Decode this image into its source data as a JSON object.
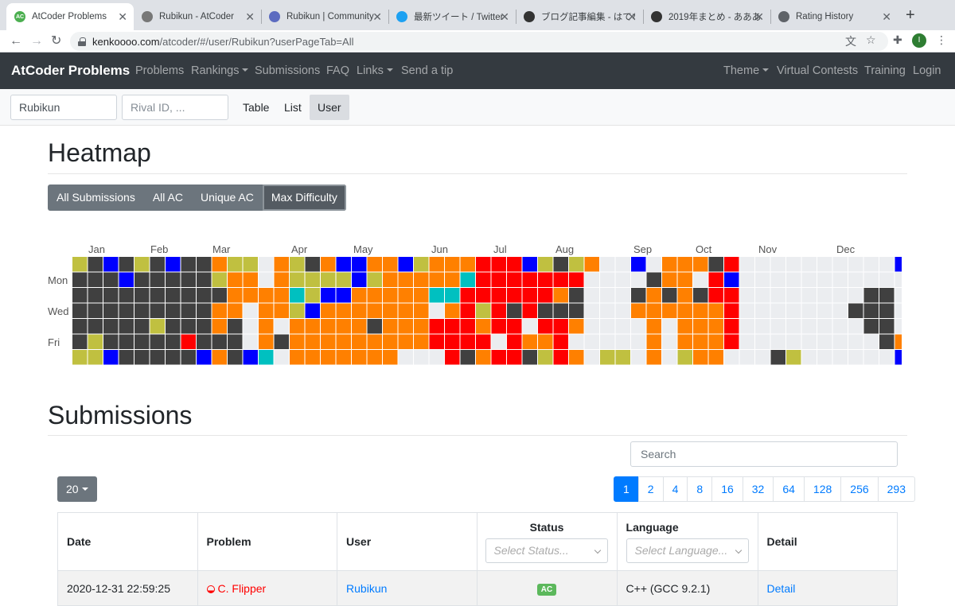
{
  "browser": {
    "tabs": [
      {
        "title": "AtCoder Problems",
        "icon": "atcoder-icon",
        "color": "#4caf50"
      },
      {
        "title": "Rubikun - AtCoder",
        "icon": "atcoder-logo-icon",
        "color": "#777777"
      },
      {
        "title": "Rubikun | Community",
        "icon": "community-icon",
        "color": "#5c6bc0"
      },
      {
        "title": "最新ツイート / Twitter",
        "icon": "twitter-icon",
        "color": "#1da1f2"
      },
      {
        "title": "ブログ記事編集 - はてな",
        "icon": "hatena-icon",
        "color": "#333333"
      },
      {
        "title": "2019年まとめ - あああ",
        "icon": "hatena-icon",
        "color": "#333333"
      },
      {
        "title": "Rating History",
        "icon": "globe-icon",
        "color": "#5f6368"
      }
    ],
    "url_host": "kenkoooo.com",
    "url_path": "/atcoder/#/user/Rubikun?userPageTab=All",
    "profile_initial": "I"
  },
  "navbar": {
    "brand": "AtCoder Problems",
    "links": [
      "Problems",
      "Rankings",
      "Submissions",
      "FAQ",
      "Links",
      "Send a tip"
    ],
    "right_links": [
      "Theme",
      "Virtual Contests",
      "Training",
      "Login"
    ]
  },
  "userbar": {
    "user_value": "Rubikun",
    "rival_placeholder": "Rival ID, ...",
    "tabs": [
      "Table",
      "List",
      "User"
    ],
    "active_tab": "User"
  },
  "heatmap": {
    "title": "Heatmap",
    "buttons": [
      "All Submissions",
      "All AC",
      "Unique AC",
      "Max Difficulty"
    ],
    "active_button": "Max Difficulty",
    "months": [
      "Jan",
      "Feb",
      "Mar",
      "Apr",
      "May",
      "Jun",
      "Jul",
      "Aug",
      "Sep",
      "Oct",
      "Nov",
      "Dec"
    ],
    "days": [
      "Mon",
      "Wed",
      "Fri"
    ],
    "colors": {
      "0": "#ebedf0",
      "1": "#404040",
      "2": "#c0c040",
      "3": "#0000ff",
      "4": "#ff8000",
      "5": "#ff0000",
      "6": "#00c0c0",
      "7": "#008000"
    },
    "weeks": [
      "2111112",
      "1111122",
      "3111113",
      "1311111",
      "2111111",
      "1111211",
      "3111111",
      "1111151",
      "1111113",
      "4214414",
      "2444111",
      "2440003",
      "0044446",
      "4444010",
      "2262444",
      "1223444",
      "4234444",
      "3234444",
      "3344444",
      "4244144",
      "4444444",
      "3444440",
      "2444440",
      "4460550",
      "4464555",
      "4655551",
      "5552454",
      "5555505",
      "5551555",
      "3555041",
      "2551542",
      "1541555",
      "2511404",
      "4000000",
      "0000002",
      "0000002",
      "3014000",
      "0144444",
      "4414000",
      "4444442",
      "4014444",
      "1554444",
      "5355550",
      "0000000",
      "0000000",
      "0000001",
      "0000002",
      "0000000",
      "0000000",
      "0000000",
      "0001000",
      "0011100",
      "0011110",
      "3000043",
      "3444555",
      "4454555",
      "0000000",
      "0054000",
      "0005055",
      "4111001",
      "2500550",
      "4500003",
      "5000002",
      "0000001",
      "0000007",
      "4000002",
      "2212115",
      "4511114",
      "4000552",
      "0455512",
      "5555550",
      "1111513",
      "0115004",
      "0150000",
      "3000000"
    ]
  },
  "submissions": {
    "title": "Submissions",
    "search_placeholder": "Search",
    "page_size": "20",
    "pages": [
      "1",
      "2",
      "4",
      "8",
      "16",
      "32",
      "64",
      "128",
      "256",
      "293"
    ],
    "active_page": "1",
    "columns": {
      "date": "Date",
      "problem": "Problem",
      "user": "User",
      "status": "Status",
      "language": "Language",
      "detail": "Detail"
    },
    "status_placeholder": "Select Status...",
    "language_placeholder": "Select Language...",
    "rows": [
      {
        "date": "2020-12-31 22:59:25",
        "problem": "C. Flipper",
        "user": "Rubikun",
        "status": "AC",
        "language": "C++ (GCC 9.2.1)",
        "detail": "Detail"
      }
    ]
  }
}
